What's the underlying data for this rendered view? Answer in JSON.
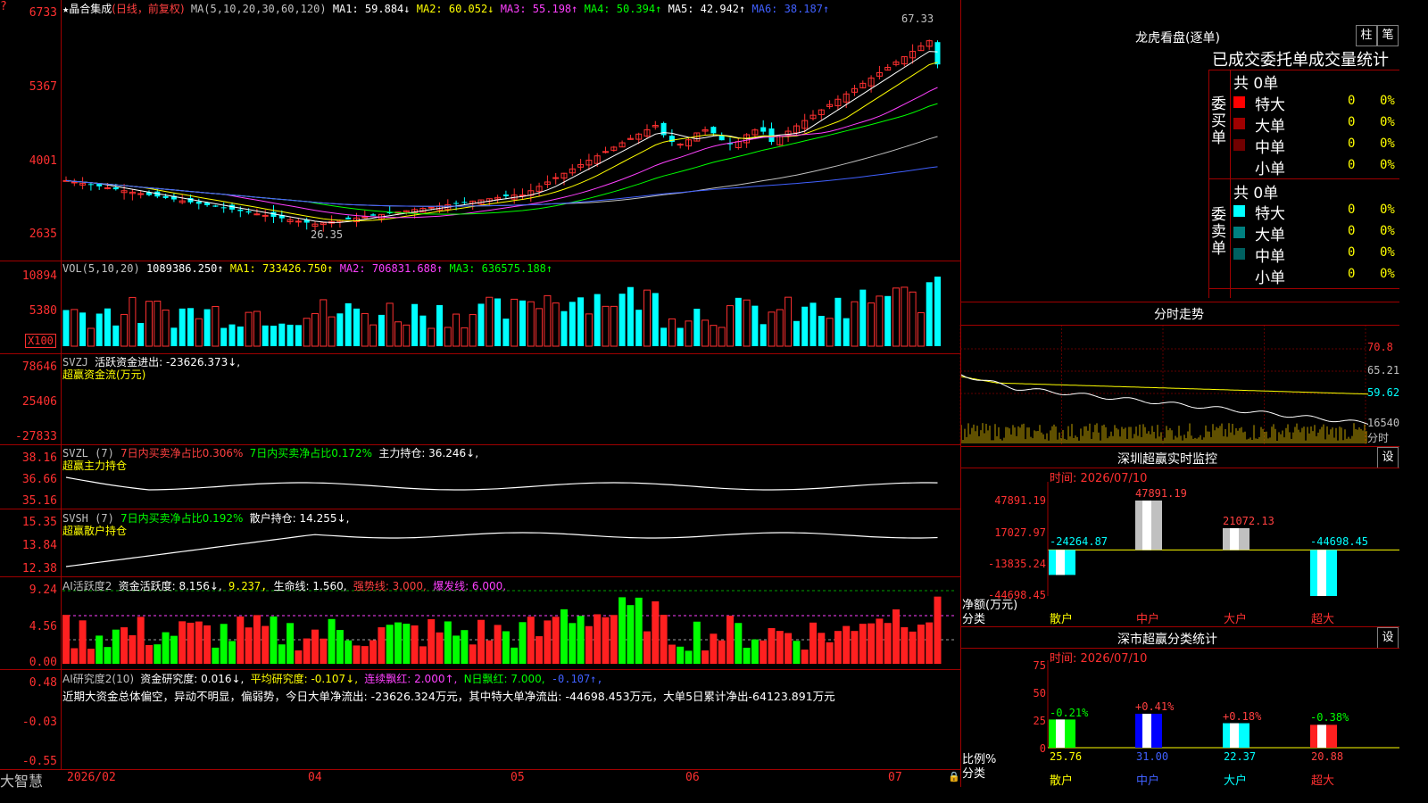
{
  "header": {
    "stock_name": "晶合集成",
    "mode": "(日线，前复权)",
    "ma_label": "MA(5,10,20,30,60,120)",
    "ma1": "MA1: 59.884↓",
    "ma2": "MA2: 60.052↓",
    "ma3": "MA3: 55.198↑",
    "ma4": "MA4: 50.394↑",
    "ma5": "MA5: 42.942↑",
    "ma6": "MA6: 38.187↑"
  },
  "price_axis": [
    "6733",
    "5367",
    "4001",
    "2635"
  ],
  "price_marks": {
    "high": "67.33",
    "low": "26.35"
  },
  "vol": {
    "label": "VOL(5,10,20)",
    "value": "1089386.250↑",
    "ma1": "MA1: 733426.750↑",
    "ma2": "MA2: 706831.688↑",
    "ma3": "MA3: 636575.188↑",
    "axis": [
      "10894",
      "5380"
    ],
    "unit": "X100"
  },
  "svzj": {
    "label": "SVZJ",
    "value": "活跃资金进出: -23626.373↓,",
    "sub": "超赢资金流(万元)",
    "axis": [
      "78646",
      "25406",
      "-27833"
    ]
  },
  "svzl": {
    "label": "SVZL (7)",
    "a": "7日内买卖净占比0.306%",
    "b": "7日内买卖净占比0.172%",
    "c": "主力持仓: 36.246↓,",
    "sub": "超赢主力持仓",
    "axis": [
      "38.16",
      "36.66",
      "35.16"
    ]
  },
  "svsh": {
    "label": "SVSH (7)",
    "a": "7日内买卖净占比0.192%",
    "c": "散户持仓: 14.255↓,",
    "sub": "超赢散户持仓",
    "axis": [
      "15.35",
      "13.84",
      "12.38"
    ]
  },
  "ai1": {
    "label": "AI活跃度2",
    "a": "资金活跃度: 8.156↓,",
    "b": "9.237,",
    "c": "生命线: 1.560,",
    "d": "强势线: 3.000,",
    "e": "爆发线: 6.000,",
    "axis": [
      "9.24",
      "4.56",
      "0.00"
    ]
  },
  "ai2": {
    "label": "AI研究度2(10)",
    "a": "资金研究度: 0.016↓,",
    "b": "平均研究度: -0.107↓,",
    "c": "连续飘红: 2.000↑,",
    "d": "N日飘红: 7.000,",
    "e": "-0.107↑,",
    "comment": "近期大资金总体偏空，异动不明显，偏弱势，今日大单净流出: -23626.324万元，其中特大单净流出: -44698.453万元，大单5日累计净出-64123.891万元",
    "axis": [
      "0.48",
      "-0.03",
      "-0.55"
    ]
  },
  "bottom": {
    "brand": "大智慧",
    "dates": [
      "2026/02",
      "04",
      "05",
      "06",
      "07"
    ]
  },
  "right": {
    "lhb_title": "龙虎看盘(逐单)",
    "btn_zhu": "柱",
    "btn_bi": "笔",
    "lhb_header": "已成交委托单成交量统计",
    "buy_label": "委买单",
    "sell_label": "委卖单",
    "buy_total": "共 0单",
    "sell_total": "共 0单",
    "buy_rows": [
      {
        "name": "特大",
        "count": "0",
        "pct": "0%",
        "color": "#ff0000"
      },
      {
        "name": "大单",
        "count": "0",
        "pct": "0%",
        "color": "#a00000"
      },
      {
        "name": "中单",
        "count": "0",
        "pct": "0%",
        "color": "#700000"
      },
      {
        "name": "小单",
        "count": "0",
        "pct": "0%",
        "color": "#000000"
      }
    ],
    "sell_rows": [
      {
        "name": "特大",
        "count": "0",
        "pct": "0%",
        "color": "#00ffff"
      },
      {
        "name": "大单",
        "count": "0",
        "pct": "0%",
        "color": "#008080"
      },
      {
        "name": "中单",
        "count": "0",
        "pct": "0%",
        "color": "#006060"
      },
      {
        "name": "小单",
        "count": "0",
        "pct": "0%",
        "color": "#000000"
      }
    ],
    "intraday_title": "分时走势",
    "intraday_axis": [
      "70.8",
      "65.21",
      "59.62",
      "16540",
      "分时"
    ],
    "monitor_title": "深圳超赢实时监控",
    "monitor_date": "时间: 2026/07/10",
    "monitor_btn": "设",
    "monitor_axis": [
      "47891.19",
      "17027.97",
      "-13835.24",
      "-44698.45"
    ],
    "monitor_ylabel1": "净额(万元)",
    "monitor_ylabel2": "分类",
    "monitor_values": [
      "-24264.87",
      "47891.19",
      "21072.13",
      "-44698.45"
    ],
    "categories": [
      "散户",
      "中户",
      "大户",
      "超大"
    ],
    "stats_title": "深市超赢分类统计",
    "stats_date": "时间: 2026/07/10",
    "stats_btn": "设",
    "stats_axis": [
      "75",
      "50",
      "25",
      "0"
    ],
    "stats_changes": [
      "-0.21%",
      "+0.41%",
      "+0.18%",
      "-0.38%"
    ],
    "stats_values": [
      "25.76",
      "31.00",
      "22.37",
      "20.88"
    ],
    "stats_ylabel1": "比例%",
    "stats_ylabel2": "分类"
  },
  "chart_data": [
    {
      "type": "bar",
      "title": "深圳超赢实时监控",
      "ylabel": "净额(万元)",
      "categories": [
        "散户",
        "中户",
        "大户",
        "超大"
      ],
      "values": [
        -24264.87,
        47891.19,
        21072.13,
        -44698.45
      ],
      "ylim": [
        -44698.45,
        47891.19
      ]
    },
    {
      "type": "bar",
      "title": "深市超赢分类统计",
      "ylabel": "比例%",
      "categories": [
        "散户",
        "中户",
        "大户",
        "超大"
      ],
      "values": [
        25.76,
        31.0,
        22.37,
        20.88
      ],
      "ylim": [
        0,
        75
      ]
    }
  ]
}
